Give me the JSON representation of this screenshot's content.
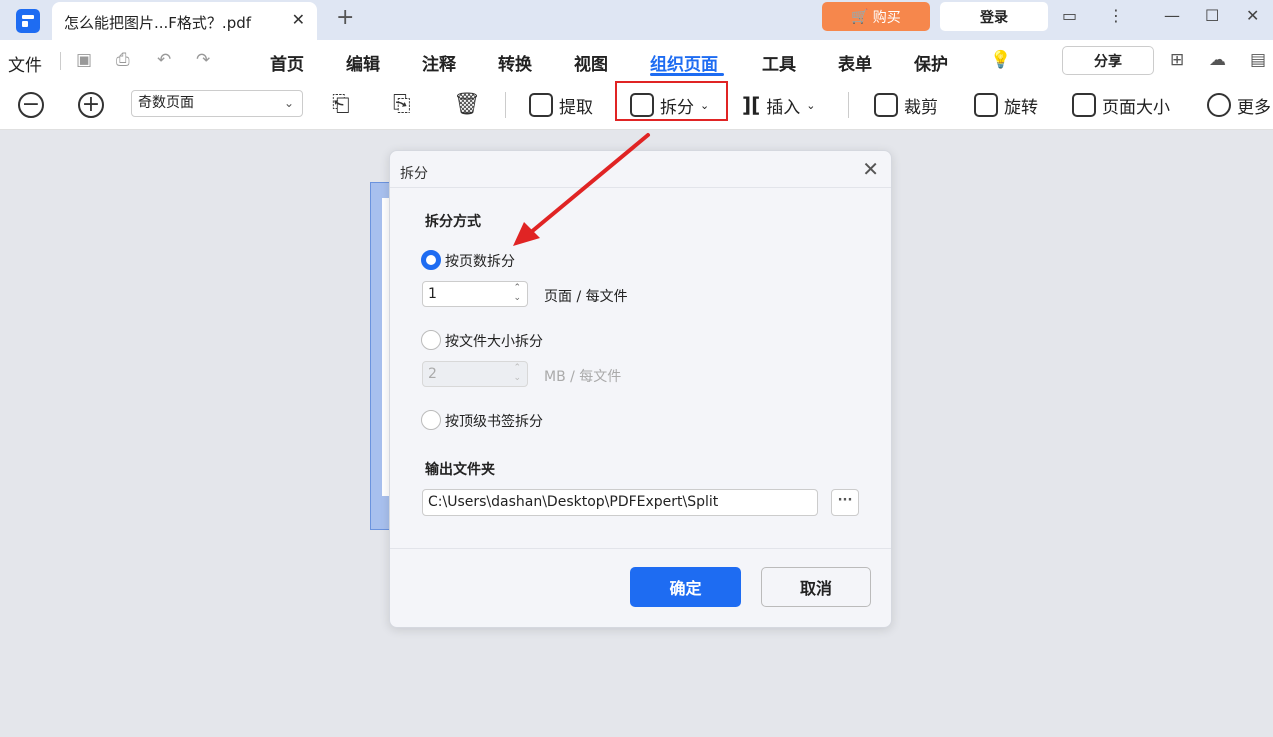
{
  "titlebar": {
    "tab_label": "怎么能把图片...F格式？.pdf",
    "tab_close": "✕",
    "new_tab": "+",
    "buy_label": "购买",
    "login_label": "登录"
  },
  "menubar": {
    "file_label": "文件",
    "items": [
      "首页",
      "编辑",
      "注释",
      "转换",
      "视图",
      "组织页面",
      "工具",
      "表单",
      "保护"
    ],
    "active_item": "组织页面",
    "share_label": "分享"
  },
  "toolbar": {
    "page_filter_value": "奇数页面",
    "extract_label": "提取",
    "split_label": "拆分",
    "insert_label": "插入",
    "crop_label": "裁剪",
    "rotate_label": "旋转",
    "page_size_label": "页面大小",
    "more_label": "更多"
  },
  "dialog": {
    "title": "拆分",
    "close": "✕",
    "split_method_label": "拆分方式",
    "options": [
      {
        "label": "按页数拆分",
        "checked": true
      },
      {
        "label": "按文件大小拆分",
        "checked": false
      },
      {
        "label": "按顶级书签拆分",
        "checked": false
      }
    ],
    "pages_value": "1",
    "pages_unit": "页面  /  每文件",
    "size_value": "2",
    "size_unit": "MB  /  每文件",
    "output_folder_label": "输出文件夹",
    "output_path": "C:\\Users\\dashan\\Desktop\\PDFExpert\\Split",
    "browse": "···",
    "ok_label": "确定",
    "cancel_label": "取消"
  },
  "colors": {
    "accent": "#1e6cf2",
    "buy": "#f6874c",
    "annotation": "#e02424"
  }
}
